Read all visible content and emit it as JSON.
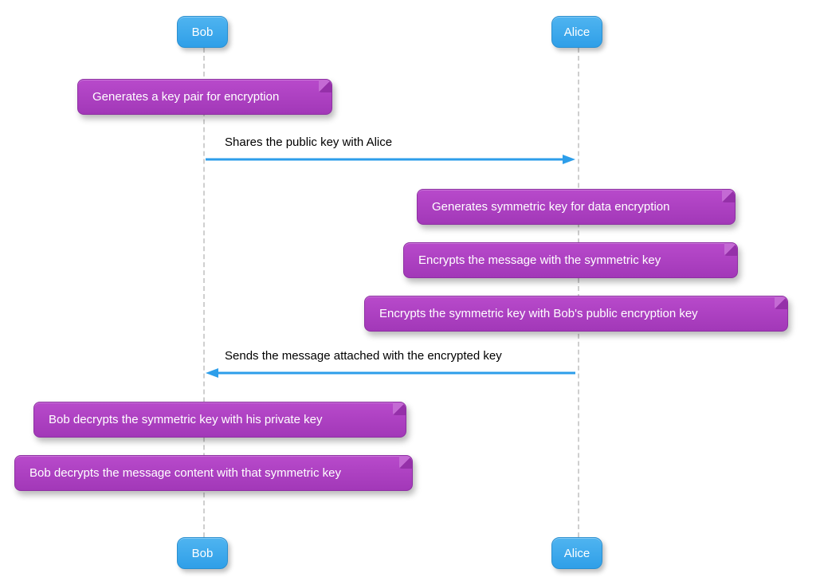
{
  "actors": {
    "bob": "Bob",
    "alice": "Alice"
  },
  "notes": {
    "n1": "Generates a key pair for encryption",
    "n2": "Generates symmetric key for data encryption",
    "n3": "Encrypts the message with the symmetric key",
    "n4": "Encrypts the symmetric key with Bob's public encryption key",
    "n5": "Bob decrypts the symmetric key with his private key",
    "n6": "Bob decrypts the message content with that symmetric key"
  },
  "messages": {
    "m1": "Shares the public key with Alice",
    "m2": "Sends the message attached with the encrypted key"
  },
  "colors": {
    "actor": "#3aa6ea",
    "note": "#a93ac0",
    "arrow": "#2d9eea"
  }
}
